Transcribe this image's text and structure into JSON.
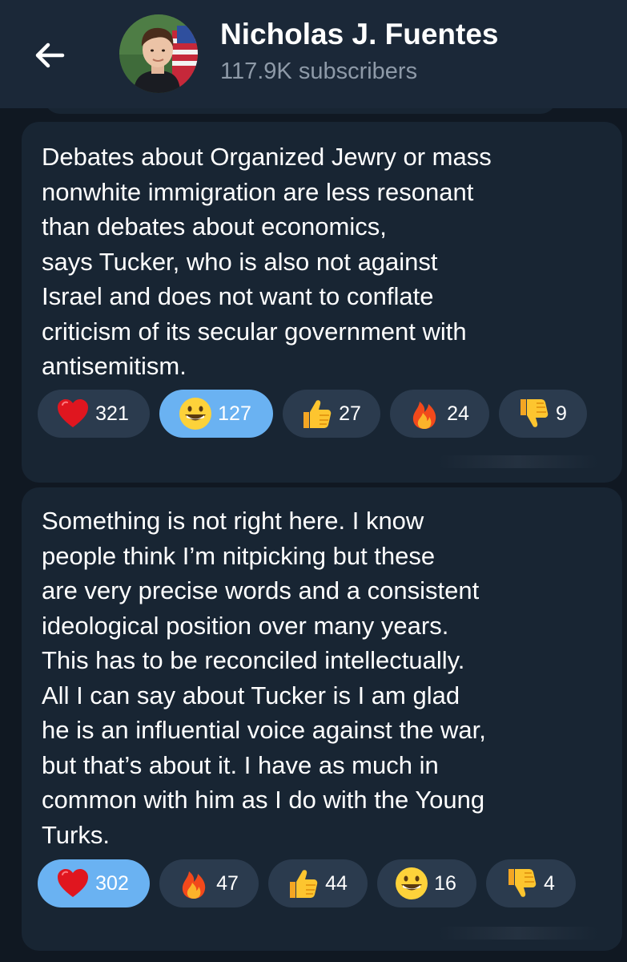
{
  "header": {
    "channel_name": "Nicholas J. Fuentes",
    "subscribers": "117.9K subscribers"
  },
  "messages": [
    {
      "text": "Debates about Organized Jewry or mass\nnonwhite immigration are less resonant\nthan debates about economics,\nsays Tucker, who is also not against\nIsrael and does not want to conflate\ncriticism of its secular government with\nantisemitism.",
      "reactions": [
        {
          "emoji": "heart-icon",
          "count": "321",
          "chosen": false
        },
        {
          "emoji": "grinning-face-icon",
          "count": "127",
          "chosen": true
        },
        {
          "emoji": "thumbs-up-icon",
          "count": "27",
          "chosen": false
        },
        {
          "emoji": "fire-icon",
          "count": "24",
          "chosen": false
        },
        {
          "emoji": "thumbs-down-icon",
          "count": "9",
          "chosen": false
        }
      ]
    },
    {
      "text": "Something is not right here. I know\npeople think I’m nitpicking but these\nare very precise words and a consistent\nideological position over many years.\nThis has to be reconciled intellectually.\nAll I can say about Tucker is I am glad\nhe is an influential voice against the war,\nbut that’s about it. I have as much in\ncommon with him as I do with the Young\nTurks.",
      "reactions": [
        {
          "emoji": "heart-icon",
          "count": "302",
          "chosen": true
        },
        {
          "emoji": "fire-icon",
          "count": "47",
          "chosen": false
        },
        {
          "emoji": "thumbs-up-icon",
          "count": "44",
          "chosen": false
        },
        {
          "emoji": "grinning-face-icon",
          "count": "16",
          "chosen": false
        },
        {
          "emoji": "thumbs-down-icon",
          "count": "4",
          "chosen": false
        }
      ]
    }
  ],
  "colors": {
    "header_bg": "#1b2838",
    "bubble_bg": "#182533",
    "reaction_bg": "#2b3b4e",
    "reaction_chosen_bg": "#6ab2f2",
    "subtitle": "#8e9aa8"
  }
}
